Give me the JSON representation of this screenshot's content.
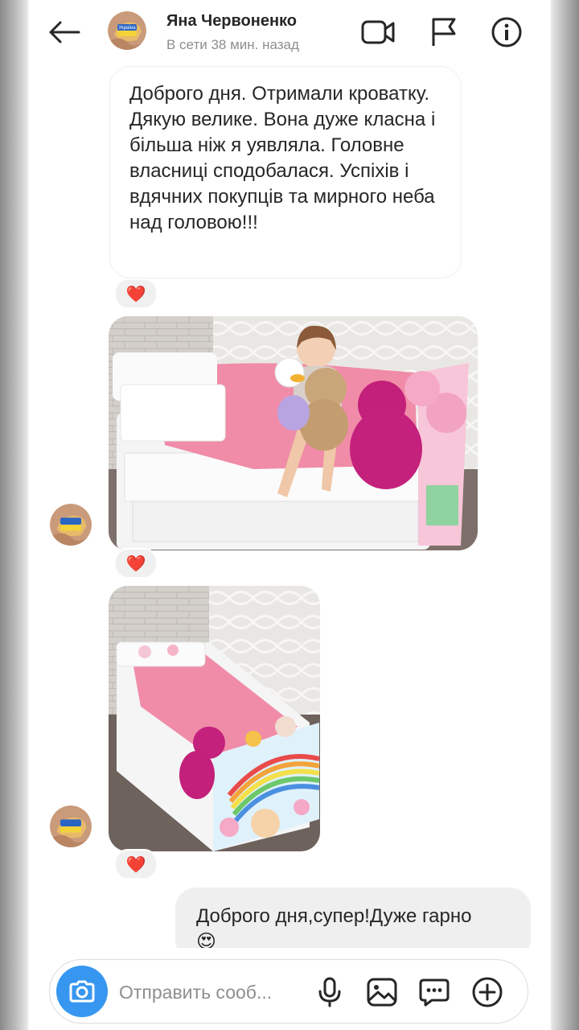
{
  "header": {
    "contact_name": "Яна Червоненко",
    "status": "В сети 38 мин. назад",
    "icons": [
      "back-arrow-icon",
      "video-call-icon",
      "flag-icon",
      "info-icon"
    ]
  },
  "messages": [
    {
      "direction": "incoming",
      "type": "text",
      "text": "Доброго дня. Отримали кроватку. Дякую велике. Вона дуже класна і більша ніж я уявляла. Головне власниці сподобалася. Успіхів і вдячних покупців та мирного неба над головою!!!",
      "reaction": "❤️"
    },
    {
      "direction": "incoming",
      "type": "image",
      "description": "girl-sitting-on-white-kids-bed-with-plush-toys",
      "reaction": "❤️"
    },
    {
      "direction": "incoming",
      "type": "image",
      "description": "white-kids-bed-with-rainbow-unicorn-side-panel",
      "reaction": "❤️"
    },
    {
      "direction": "outgoing",
      "type": "text",
      "text": "Доброго дня,супер!Дуже гарно",
      "emoji": "😍"
    }
  ],
  "composer": {
    "placeholder": "Отправить сооб...",
    "value": "",
    "icons": [
      "camera-icon",
      "microphone-icon",
      "gallery-icon",
      "sticker-icon",
      "plus-icon"
    ]
  },
  "colors": {
    "accent": "#3797f0",
    "heart": "#ed1c24",
    "bubble_in_border": "#efefef",
    "bubble_out_bg": "#efefef",
    "text": "#262626",
    "muted": "#8e8e8e"
  }
}
